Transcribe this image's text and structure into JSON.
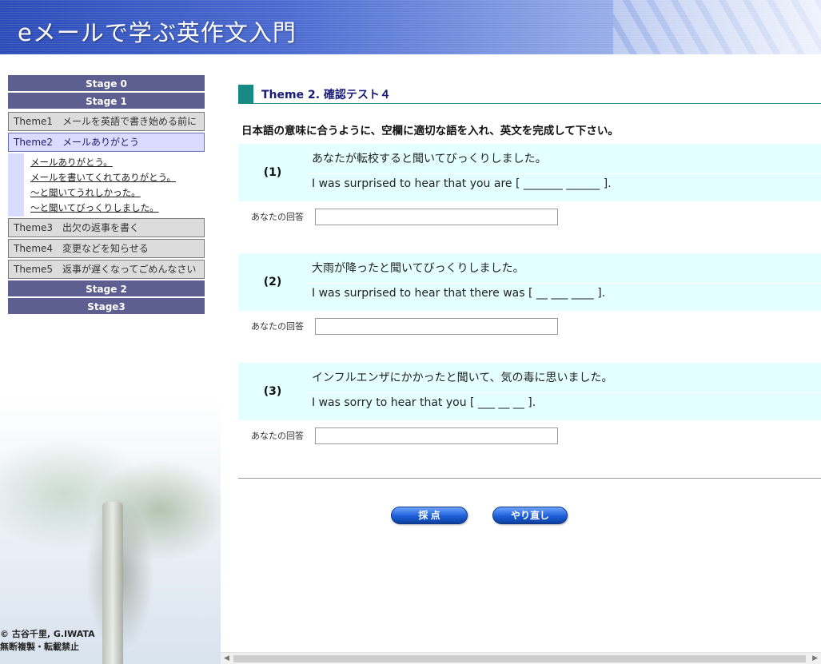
{
  "header": {
    "title": "eメールで学ぶ英作文入門"
  },
  "sidebar": {
    "stage0": "Stage 0",
    "stage1": "Stage 1",
    "themes": [
      {
        "label": "Theme1　メールを英語で書き始める前に"
      },
      {
        "label": "Theme2　メールありがとう"
      },
      {
        "label": "Theme3　出欠の返事を書く"
      },
      {
        "label": "Theme4　変更などを知らせる"
      },
      {
        "label": "Theme5　返事が遅くなってごめんなさい"
      }
    ],
    "subitems": [
      "メールありがとう。",
      "メールを書いてくれてありがとう。",
      "～と聞いてうれしかった。",
      "～と聞いてびっくりしました。"
    ],
    "stage2": "Stage 2",
    "stage3": "Stage3",
    "copyright_line1": "© 古谷千里, G.IWATA",
    "copyright_line2": "無断複製・転載禁止"
  },
  "main": {
    "heading": "Theme 2. 確認テスト４",
    "instruction": "日本語の意味に合うように、空欄に適切な語を入れ、英文を完成して下さい。",
    "answer_label": "あなたの回答",
    "questions": [
      {
        "num": "(1)",
        "jp": "あなたが転校すると聞いてびっくりしました。",
        "en": "I was surprised to hear that you are [ _______ ______ ].",
        "answer": ""
      },
      {
        "num": "(2)",
        "jp": "大雨が降ったと聞いてびっくりしました。",
        "en": "I was surprised to hear that there was [ __ ___ ____ ].",
        "answer": ""
      },
      {
        "num": "(3)",
        "jp": "インフルエンザにかかったと聞いて、気の毒に思いました。",
        "en": "I was sorry to hear that you [ ___ __ __ ].",
        "answer": ""
      }
    ],
    "buttons": {
      "grade": "採 点",
      "retry": "やり直し"
    }
  },
  "colors": {
    "stage_bg": "#5d5f91",
    "theme_active_bg": "#d9dcff",
    "question_bg": "#e3ffff",
    "heading_marker": "#178a83",
    "button_blue": "#1d5fd8"
  }
}
